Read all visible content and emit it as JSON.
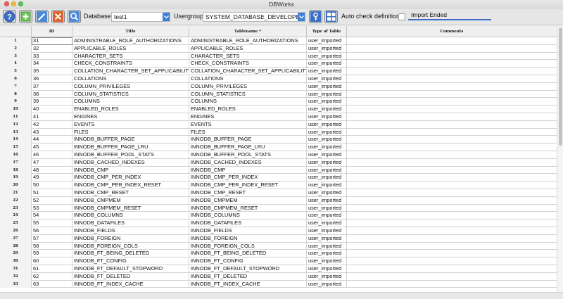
{
  "window": {
    "title": "DBWorks"
  },
  "toolbar": {
    "buttons": [
      {
        "name": "help-button",
        "icon": "question-icon"
      },
      {
        "name": "add-button",
        "icon": "plus-icon"
      },
      {
        "name": "edit-button",
        "icon": "pencil-icon"
      },
      {
        "name": "delete-button",
        "icon": "x-icon"
      },
      {
        "name": "search-button",
        "icon": "search-icon"
      }
    ],
    "database_label": "Database",
    "database_value": "test1",
    "usergroup_label": "Usergroup",
    "usergroup_value": "SYSTEM_DATABASE_DEVELOPER",
    "auto_check_label": "Auto check definitions",
    "auto_check_checked": false,
    "status_text": "Import Ended",
    "accent_color": "#3b7fd9"
  },
  "table": {
    "columns": [
      "",
      "ID",
      "Title",
      "Tablename *",
      "Type of Table",
      "Comments"
    ],
    "rows": [
      {
        "n": "1",
        "id": "31",
        "title": "ADMINISTRABLE_ROLE_AUTHORIZATIONS",
        "tablename": "ADMINISTRABLE_ROLE_AUTHORIZATIONS",
        "type": "user_imported",
        "comments": ""
      },
      {
        "n": "2",
        "id": "32",
        "title": "APPLICABLE_ROLES",
        "tablename": "APPLICABLE_ROLES",
        "type": "user_imported",
        "comments": ""
      },
      {
        "n": "3",
        "id": "33",
        "title": "CHARACTER_SETS",
        "tablename": "CHARACTER_SETS",
        "type": "user_imported",
        "comments": ""
      },
      {
        "n": "4",
        "id": "34",
        "title": "CHECK_CONSTRAINTS",
        "tablename": "CHECK_CONSTRAINTS",
        "type": "user_imported",
        "comments": ""
      },
      {
        "n": "5",
        "id": "35",
        "title": "COLLATION_CHARACTER_SET_APPLICABILITY",
        "tablename": "COLLATION_CHARACTER_SET_APPLICABILITY",
        "type": "user_imported",
        "comments": ""
      },
      {
        "n": "6",
        "id": "36",
        "title": "COLLATIONS",
        "tablename": "COLLATIONS",
        "type": "user_imported",
        "comments": ""
      },
      {
        "n": "7",
        "id": "37",
        "title": "COLUMN_PRIVILEGES",
        "tablename": "COLUMN_PRIVILEGES",
        "type": "user_imported",
        "comments": ""
      },
      {
        "n": "8",
        "id": "38",
        "title": "COLUMN_STATISTICS",
        "tablename": "COLUMN_STATISTICS",
        "type": "user_imported",
        "comments": ""
      },
      {
        "n": "9",
        "id": "39",
        "title": "COLUMNS",
        "tablename": "COLUMNS",
        "type": "user_imported",
        "comments": ""
      },
      {
        "n": "10",
        "id": "40",
        "title": "ENABLED_ROLES",
        "tablename": "ENABLED_ROLES",
        "type": "user_imported",
        "comments": ""
      },
      {
        "n": "11",
        "id": "41",
        "title": "ENGINES",
        "tablename": "ENGINES",
        "type": "user_imported",
        "comments": ""
      },
      {
        "n": "12",
        "id": "42",
        "title": "EVENTS",
        "tablename": "EVENTS",
        "type": "user_imported",
        "comments": ""
      },
      {
        "n": "13",
        "id": "43",
        "title": "FILES",
        "tablename": "FILES",
        "type": "user_imported",
        "comments": ""
      },
      {
        "n": "14",
        "id": "44",
        "title": "INNODB_BUFFER_PAGE",
        "tablename": "INNODB_BUFFER_PAGE",
        "type": "user_imported",
        "comments": ""
      },
      {
        "n": "15",
        "id": "45",
        "title": "INNODB_BUFFER_PAGE_LRU",
        "tablename": "INNODB_BUFFER_PAGE_LRU",
        "type": "user_imported",
        "comments": ""
      },
      {
        "n": "16",
        "id": "46",
        "title": "INNODB_BUFFER_POOL_STATS",
        "tablename": "INNODB_BUFFER_POOL_STATS",
        "type": "user_imported",
        "comments": ""
      },
      {
        "n": "17",
        "id": "47",
        "title": "INNODB_CACHED_INDEXES",
        "tablename": "INNODB_CACHED_INDEXES",
        "type": "user_imported",
        "comments": ""
      },
      {
        "n": "18",
        "id": "48",
        "title": "INNODB_CMP",
        "tablename": "INNODB_CMP",
        "type": "user_imported",
        "comments": ""
      },
      {
        "n": "19",
        "id": "49",
        "title": "INNODB_CMP_PER_INDEX",
        "tablename": "INNODB_CMP_PER_INDEX",
        "type": "user_imported",
        "comments": ""
      },
      {
        "n": "20",
        "id": "50",
        "title": "INNODB_CMP_PER_INDEX_RESET",
        "tablename": "INNODB_CMP_PER_INDEX_RESET",
        "type": "user_imported",
        "comments": ""
      },
      {
        "n": "21",
        "id": "51",
        "title": "INNODB_CMP_RESET",
        "tablename": "INNODB_CMP_RESET",
        "type": "user_imported",
        "comments": ""
      },
      {
        "n": "22",
        "id": "52",
        "title": "INNODB_CMPMEM",
        "tablename": "INNODB_CMPMEM",
        "type": "user_imported",
        "comments": ""
      },
      {
        "n": "23",
        "id": "53",
        "title": "INNODB_CMPMEM_RESET",
        "tablename": "INNODB_CMPMEM_RESET",
        "type": "user_imported",
        "comments": ""
      },
      {
        "n": "24",
        "id": "54",
        "title": "INNODB_COLUMNS",
        "tablename": "INNODB_COLUMNS",
        "type": "user_imported",
        "comments": ""
      },
      {
        "n": "25",
        "id": "55",
        "title": "INNODB_DATAFILES",
        "tablename": "INNODB_DATAFILES",
        "type": "user_imported",
        "comments": ""
      },
      {
        "n": "26",
        "id": "56",
        "title": "INNODB_FIELDS",
        "tablename": "INNODB_FIELDS",
        "type": "user_imported",
        "comments": ""
      },
      {
        "n": "27",
        "id": "57",
        "title": "INNODB_FOREIGN",
        "tablename": "INNODB_FOREIGN",
        "type": "user_imported",
        "comments": ""
      },
      {
        "n": "28",
        "id": "58",
        "title": "INNODB_FOREIGN_COLS",
        "tablename": "INNODB_FOREIGN_COLS",
        "type": "user_imported",
        "comments": ""
      },
      {
        "n": "29",
        "id": "59",
        "title": "INNODB_FT_BEING_DELETED",
        "tablename": "INNODB_FT_BEING_DELETED",
        "type": "user_imported",
        "comments": ""
      },
      {
        "n": "30",
        "id": "60",
        "title": "INNODB_FT_CONFIG",
        "tablename": "INNODB_FT_CONFIG",
        "type": "user_imported",
        "comments": ""
      },
      {
        "n": "31",
        "id": "61",
        "title": "INNODB_FT_DEFAULT_STOPWORD",
        "tablename": "INNODB_FT_DEFAULT_STOPWORD",
        "type": "user_imported",
        "comments": ""
      },
      {
        "n": "32",
        "id": "62",
        "title": "INNODB_FT_DELETED",
        "tablename": "INNODB_FT_DELETED",
        "type": "user_imported",
        "comments": ""
      },
      {
        "n": "33",
        "id": "63",
        "title": "INNODB_FT_INDEX_CACHE",
        "tablename": "INNODB_FT_INDEX_CACHE",
        "type": "user_imported",
        "comments": ""
      }
    ]
  }
}
